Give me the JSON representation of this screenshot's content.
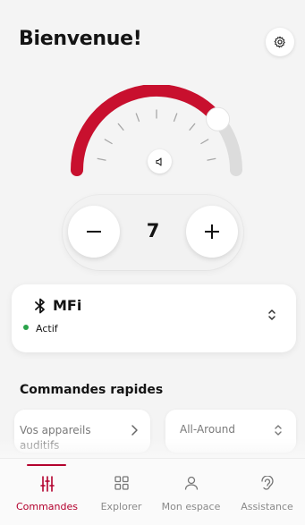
{
  "header": {
    "title": "Bienvenue!"
  },
  "volume": {
    "level": 7,
    "ring_fraction": 0.78,
    "accent_color": "#c8102e"
  },
  "stepper": {
    "value": "7"
  },
  "device": {
    "name": "MFi",
    "status": "Actif",
    "status_color": "#2aa34a"
  },
  "quick_commands": {
    "title": "Commandes rapides",
    "items": [
      {
        "label": "Vos appareils auditifs"
      },
      {
        "label": "All-Around"
      }
    ]
  },
  "nav": {
    "items": [
      {
        "label": "Commandes",
        "icon": "sliders-icon",
        "active": true
      },
      {
        "label": "Explorer",
        "icon": "grid-icon"
      },
      {
        "label": "Mon espace",
        "icon": "person-icon"
      },
      {
        "label": "Assistance",
        "icon": "ear-icon"
      }
    ],
    "active_color": "#b3002d"
  }
}
